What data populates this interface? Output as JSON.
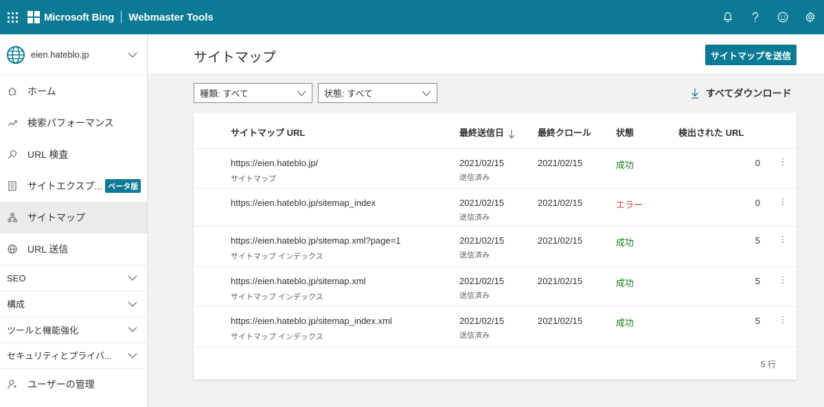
{
  "topbar": {
    "brand": "Microsoft Bing",
    "product": "Webmaster Tools"
  },
  "sidebar": {
    "site": "eien.hateblo.jp",
    "items": [
      {
        "label": "ホーム",
        "icon": "home-icon"
      },
      {
        "label": "検索パフォーマンス",
        "icon": "trend-icon"
      },
      {
        "label": "URL 検査",
        "icon": "search-icon"
      },
      {
        "label": "サイトエクスプ...",
        "icon": "document-icon",
        "badge": "ベータ版"
      },
      {
        "label": "サイトマップ",
        "icon": "sitemap-icon",
        "active": true
      },
      {
        "label": "URL 送信",
        "icon": "globe-icon"
      }
    ],
    "sections": [
      "SEO",
      "構成",
      "ツールと機能強化",
      "セキュリティとプライバ..."
    ],
    "bottom": "ユーザーの管理"
  },
  "header": {
    "title": "サイトマップ",
    "submit_label": "サイトマップを送信"
  },
  "filters": {
    "type": "種類: すべて",
    "status": "状態: すべて",
    "download": "すべてダウンロード"
  },
  "table": {
    "columns": {
      "url": "サイトマップ URL",
      "submitted": "最終送信日",
      "crawled": "最終クロール",
      "status": "状態",
      "discovered": "検出された URL"
    },
    "rows": [
      {
        "url": "https://eien.hateblo.jp/",
        "type": "サイトマップ",
        "submitted": "2021/02/15",
        "submitted_note": "送信済み",
        "crawled": "2021/02/15",
        "status": "成功",
        "status_kind": "ok",
        "count": "0"
      },
      {
        "url": "https://eien.hateblo.jp/sitemap_index",
        "type": "",
        "submitted": "2021/02/15",
        "submitted_note": "送信済み",
        "crawled": "2021/02/15",
        "status": "エラー",
        "status_kind": "err",
        "count": "0"
      },
      {
        "url": "https://eien.hateblo.jp/sitemap.xml?page=1",
        "type": "サイトマップ インデックス",
        "submitted": "2021/02/15",
        "submitted_note": "送信済み",
        "crawled": "2021/02/15",
        "status": "成功",
        "status_kind": "ok",
        "count": "5"
      },
      {
        "url": "https://eien.hateblo.jp/sitemap.xml",
        "type": "サイトマップ インデックス",
        "submitted": "2021/02/15",
        "submitted_note": "送信済み",
        "crawled": "2021/02/15",
        "status": "成功",
        "status_kind": "ok",
        "count": "5"
      },
      {
        "url": "https://eien.hateblo.jp/sitemap_index.xml",
        "type": "サイトマップ インデックス",
        "submitted": "2021/02/15",
        "submitted_note": "送信済み",
        "crawled": "2021/02/15",
        "status": "成功",
        "status_kind": "ok",
        "count": "5"
      }
    ],
    "row_count": "5 行"
  },
  "colors": {
    "brand": "#0b7a95",
    "success": "#107c10",
    "error": "#d13438"
  }
}
